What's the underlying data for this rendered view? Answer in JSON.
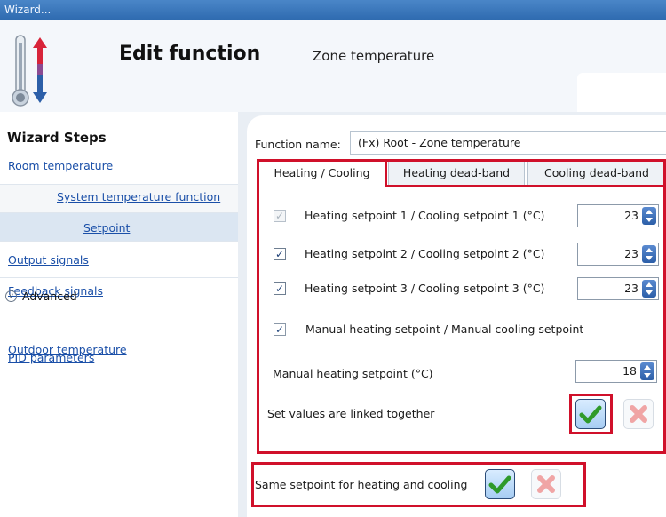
{
  "window": {
    "title": "Wizard..."
  },
  "header": {
    "title": "Edit function",
    "subtitle": "Zone temperature",
    "icon": "thermometer-icon"
  },
  "sidebar": {
    "heading": "Wizard Steps",
    "items": [
      {
        "label": "Room temperature"
      },
      {
        "label": "System temperature function"
      },
      {
        "label": "Setpoint"
      },
      {
        "label": "Output signals"
      },
      {
        "label": "Feedback signals"
      },
      {
        "label": "Advanced"
      },
      {
        "label": "Outdoor temperature"
      },
      {
        "label": "PID parameters"
      }
    ],
    "selected": "Setpoint"
  },
  "main": {
    "function_name_label": "Function name:",
    "function_name_value": "(Fx) Root - Zone temperature",
    "tabs": [
      {
        "label": "Heating / Cooling",
        "active": true
      },
      {
        "label": "Heating dead-band",
        "active": false
      },
      {
        "label": "Cooling dead-band",
        "active": false
      }
    ],
    "setpoints": [
      {
        "label": "Heating setpoint 1 / Cooling setpoint 1 (°C)",
        "value": "23",
        "checked": true,
        "enabled": false
      },
      {
        "label": "Heating setpoint 2 / Cooling setpoint 2 (°C)",
        "value": "23",
        "checked": true,
        "enabled": true
      },
      {
        "label": "Heating setpoint 3 / Cooling setpoint 3 (°C)",
        "value": "23",
        "checked": true,
        "enabled": true
      }
    ],
    "manual_checkbox_label": "Manual heating setpoint / Manual cooling setpoint",
    "manual_heating_label": "Manual heating setpoint (°C)",
    "manual_heating_value": "18",
    "linked_label": "Set values are linked together",
    "same_setpoint_label": "Same setpoint for heating and cooling"
  },
  "colors": {
    "highlight": "#d0102a",
    "link": "#1a4fa8",
    "titlebar": "#2f6bb0"
  }
}
